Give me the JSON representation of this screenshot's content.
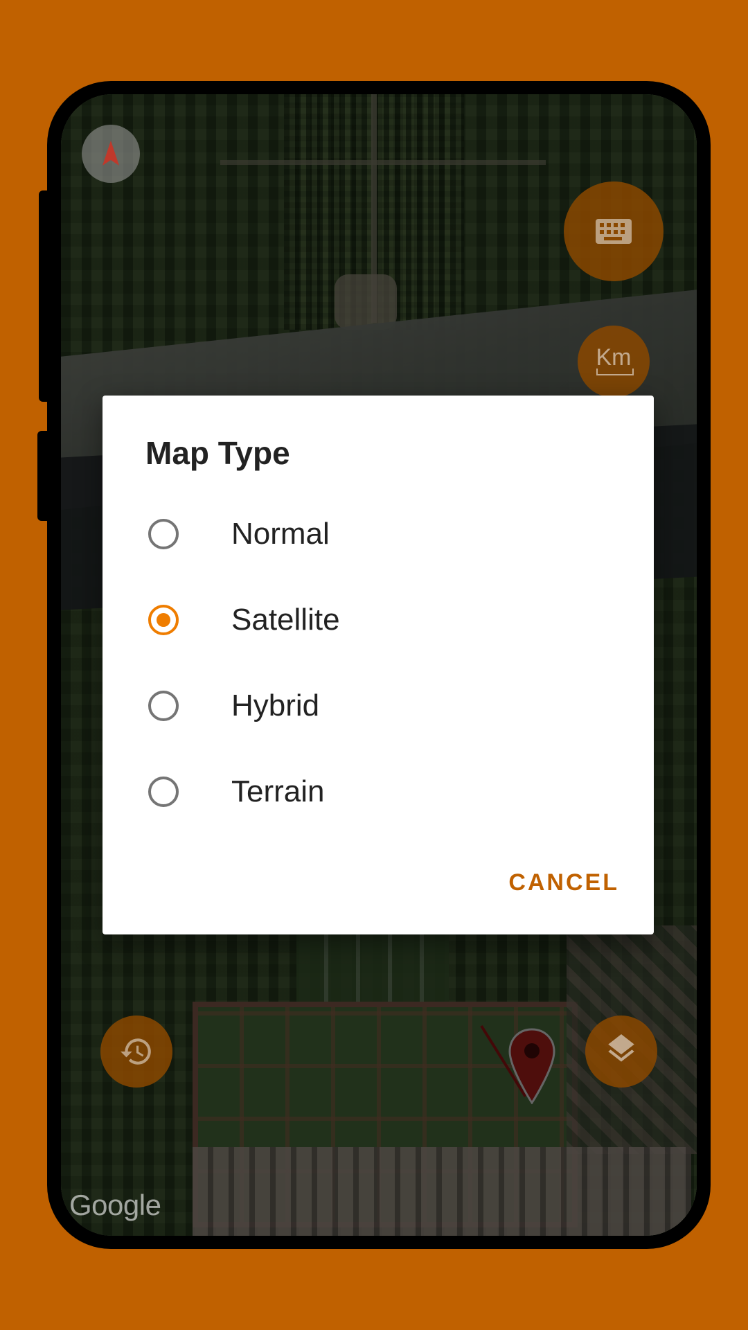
{
  "dialog": {
    "title": "Map Type",
    "options": [
      {
        "label": "Normal",
        "selected": false
      },
      {
        "label": "Satellite",
        "selected": true
      },
      {
        "label": "Hybrid",
        "selected": false
      },
      {
        "label": "Terrain",
        "selected": false
      }
    ],
    "cancel_label": "CANCEL"
  },
  "map": {
    "attribution": "Google",
    "distance_unit": "Km",
    "controls": {
      "compass_icon": "compass-icon",
      "keyboard_icon": "keyboard-icon",
      "history_icon": "history-icon",
      "layers_icon": "layers-icon",
      "marker_icon": "map-pin-icon"
    }
  },
  "colors": {
    "accent": "#ef7d00",
    "background": "#c06100",
    "action_text": "#c06100",
    "fab": "#8a4800"
  }
}
